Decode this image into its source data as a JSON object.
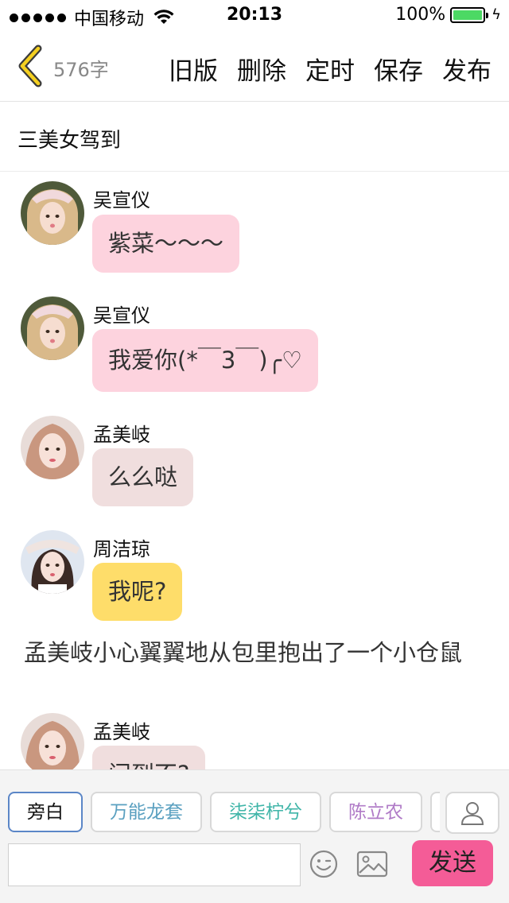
{
  "status_bar": {
    "carrier": "中国移动",
    "time": "20:13",
    "battery": "100%"
  },
  "nav": {
    "word_count": "576字",
    "actions": [
      "旧版",
      "删除",
      "定时",
      "保存",
      "发布"
    ]
  },
  "story_title": "三美女驾到",
  "messages": [
    {
      "sender": "吴宣仪",
      "text": "紫菜～～～",
      "bubble_color": "#fdd3de",
      "avatar": "wu-xuanyi"
    },
    {
      "sender": "吴宣仪",
      "text": "我爱你(*￣3￣)╭♡",
      "bubble_color": "#fdd3de",
      "avatar": "wu-xuanyi"
    },
    {
      "sender": "孟美岐",
      "text": "么么哒",
      "bubble_color": "#f0dede",
      "avatar": "meng-meiqi"
    },
    {
      "sender": "周洁琼",
      "text": "我呢?",
      "bubble_color": "#fedd6a",
      "avatar": "zhou-jieqiong"
    },
    {
      "narration": "孟美岐小心翼翼地从包里抱出了一个小仓鼠"
    },
    {
      "sender": "孟美岐",
      "text": "问到不?",
      "bubble_color": "#f0dede",
      "avatar": "meng-meiqi"
    }
  ],
  "composer": {
    "roles": [
      {
        "label": "旁白",
        "color": "#111111",
        "active": true
      },
      {
        "label": "万能龙套",
        "color": "#5aa0c0",
        "active": false
      },
      {
        "label": "柒柒柠兮",
        "color": "#3fb5a8",
        "active": false
      },
      {
        "label": "陈立农",
        "color": "#b07bc7",
        "active": false
      }
    ],
    "input_placeholder": "",
    "send_label": "发送",
    "icons": [
      "person-icon",
      "emoji-icon",
      "image-icon"
    ]
  }
}
